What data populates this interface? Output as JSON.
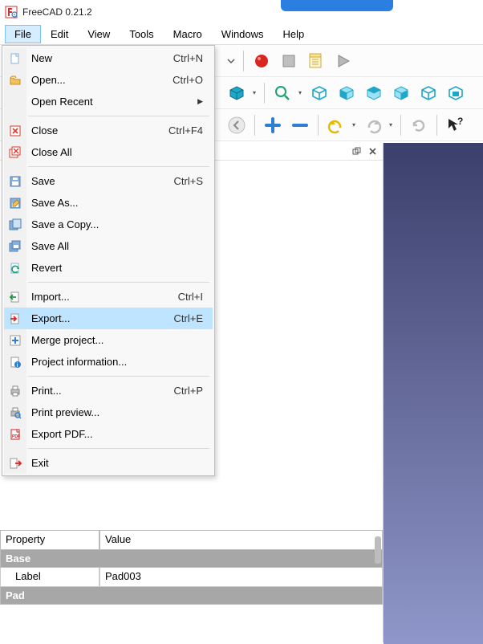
{
  "app": {
    "title": "FreeCAD 0.21.2"
  },
  "menubar": [
    "File",
    "Edit",
    "View",
    "Tools",
    "Macro",
    "Windows",
    "Help"
  ],
  "file_menu": {
    "items": [
      {
        "label": "New",
        "accel": "Ctrl+N",
        "icon": "doc-new"
      },
      {
        "label": "Open...",
        "accel": "Ctrl+O",
        "icon": "folder-open"
      },
      {
        "label": "Open Recent",
        "accel": "",
        "icon": "",
        "submenu": true
      },
      "---",
      {
        "label": "Close",
        "accel": "Ctrl+F4",
        "icon": "close-red"
      },
      {
        "label": "Close All",
        "accel": "",
        "icon": "close-all"
      },
      "---",
      {
        "label": "Save",
        "accel": "Ctrl+S",
        "icon": "save"
      },
      {
        "label": "Save As...",
        "accel": "",
        "icon": "save-as"
      },
      {
        "label": "Save a Copy...",
        "accel": "",
        "icon": "save-copy"
      },
      {
        "label": "Save All",
        "accel": "",
        "icon": "save-all"
      },
      {
        "label": "Revert",
        "accel": "",
        "icon": "revert"
      },
      "---",
      {
        "label": "Import...",
        "accel": "Ctrl+I",
        "icon": "import"
      },
      {
        "label": "Export...",
        "accel": "Ctrl+E",
        "icon": "export",
        "highlight": true
      },
      {
        "label": "Merge project...",
        "accel": "",
        "icon": "merge"
      },
      {
        "label": "Project information...",
        "accel": "",
        "icon": "info"
      },
      "---",
      {
        "label": "Print...",
        "accel": "Ctrl+P",
        "icon": "print"
      },
      {
        "label": "Print preview...",
        "accel": "",
        "icon": "print-preview"
      },
      {
        "label": "Export PDF...",
        "accel": "",
        "icon": "pdf"
      },
      "---",
      {
        "label": "Exit",
        "accel": "",
        "icon": "exit"
      }
    ]
  },
  "toolbar": {
    "row1": [
      {
        "icon": "dropdown",
        "name": "workbench-dropdown"
      },
      {
        "icon": "record",
        "name": "macro-record-button"
      },
      {
        "icon": "stop",
        "name": "macro-stop-button"
      },
      {
        "icon": "notepad",
        "name": "macro-edit-button"
      },
      {
        "icon": "play",
        "name": "macro-run-button"
      }
    ],
    "row2": [
      {
        "icon": "cube-drop",
        "name": "view-modes-button"
      },
      {
        "icon": "zoom-reset",
        "name": "zoom-button"
      },
      {
        "icon": "cube-wire",
        "name": "iso-view-button"
      },
      {
        "icon": "cube-front",
        "name": "front-view-button"
      },
      {
        "icon": "cube-top",
        "name": "top-view-button"
      },
      {
        "icon": "cube-right",
        "name": "right-view-button"
      },
      {
        "icon": "cube-back",
        "name": "back-view-button"
      },
      {
        "icon": "cube-other",
        "name": "bottom-view-button"
      }
    ],
    "row3": [
      {
        "icon": "back-round",
        "name": "nav-back-button"
      },
      null,
      {
        "icon": "plus",
        "name": "zoom-in-button"
      },
      {
        "icon": "minus",
        "name": "zoom-out-button"
      },
      null,
      {
        "icon": "undo",
        "name": "undo-button"
      },
      {
        "icon": "redo",
        "name": "redo-button"
      },
      null,
      {
        "icon": "refresh",
        "name": "refresh-button"
      },
      null,
      {
        "icon": "help-cursor",
        "name": "whats-this-button"
      }
    ]
  },
  "property_panel": {
    "columns": {
      "property": "Property",
      "value": "Value"
    },
    "groups": [
      {
        "name": "Base",
        "rows": [
          {
            "property": "Label",
            "value": "Pad003"
          }
        ]
      },
      {
        "name": "Pad",
        "rows": []
      }
    ]
  }
}
